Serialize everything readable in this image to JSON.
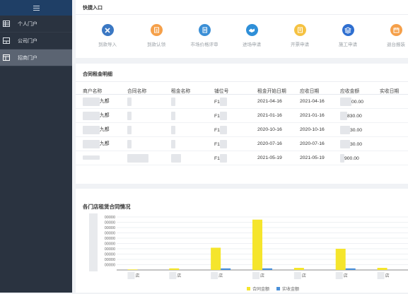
{
  "sidebar": {
    "toggle_icon": "menu-icon",
    "items": [
      {
        "label": "个人门户",
        "icon": "table-icon",
        "active": false
      },
      {
        "label": "公司门户",
        "icon": "layout-icon",
        "active": false
      },
      {
        "label": "招商门户",
        "icon": "grid-icon",
        "active": true
      }
    ]
  },
  "quick_entry": {
    "title": "快捷入口",
    "items": [
      {
        "label": "到款导入",
        "icon": "tools-icon",
        "color": "#3b78c3"
      },
      {
        "label": "到款认领",
        "icon": "clipboard-icon",
        "color": "#f5a04a"
      },
      {
        "label": "市场价格评审",
        "icon": "document-icon",
        "color": "#3b8fd6"
      },
      {
        "label": "进场申请",
        "icon": "handshake-icon",
        "color": "#2f8fd8"
      },
      {
        "label": "开票申请",
        "icon": "invoice-icon",
        "color": "#f5c242"
      },
      {
        "label": "施工申请",
        "icon": "layers-icon",
        "color": "#2f6fd0"
      },
      {
        "label": "退台报装",
        "icon": "calendar-icon",
        "color": "#f5a04a"
      }
    ]
  },
  "contract": {
    "title": "合同租金明细",
    "columns": [
      "商户名称",
      "合同名称",
      "租金名称",
      "铺位号",
      "租金开始日期",
      "应收日期",
      "应收金额",
      "实收日期"
    ],
    "rows": [
      {
        "shop": "九都",
        "unit": "F1",
        "start": "2021-04-16",
        "due": "2021-04-16",
        "amount": "00.00"
      },
      {
        "shop": "九都",
        "unit": "F1",
        "start": "2021-01-16",
        "due": "2021-01-16",
        "amount": "830.00"
      },
      {
        "shop": "九都",
        "unit": "F1",
        "start": "2020-10-16",
        "due": "2020-10-16",
        "amount": "30.00"
      },
      {
        "shop": "九都",
        "unit": "F1",
        "start": "2020-07-16",
        "due": "2020-07-16",
        "amount": "30.00"
      },
      {
        "shop": "",
        "unit": "F1",
        "start": "2021-05-19",
        "due": "2021-05-19",
        "amount": "900.00"
      }
    ]
  },
  "chart_data": {
    "type": "bar",
    "title": "各门店租赁合同情况",
    "y_tick_suffix": "00000",
    "categories": [
      "店",
      "店",
      "店",
      "店",
      "店",
      "店",
      "店"
    ],
    "series": [
      {
        "name": "合同金额",
        "color": "#f5e52c",
        "values": [
          1,
          3,
          42,
          95,
          4,
          40,
          4
        ]
      },
      {
        "name": "实收金额",
        "color": "#4a90d9",
        "values": [
          0,
          0,
          3,
          3,
          0,
          3,
          0
        ]
      }
    ],
    "ylim": [
      0,
      100
    ],
    "legend": "bottom-center"
  }
}
